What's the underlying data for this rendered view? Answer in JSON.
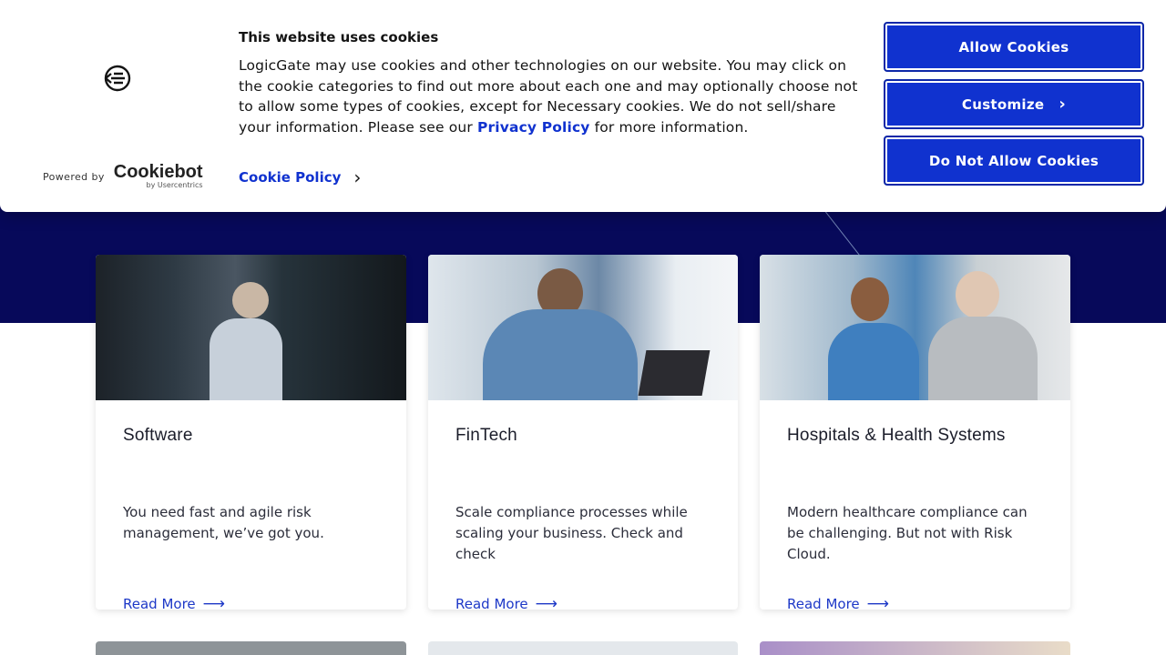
{
  "cookie_banner": {
    "title": "This website uses cookies",
    "text_before_link": "LogicGate may use cookies and other technologies on our website. You may click on the cookie categories to find out more about each one and may optionally choose not to allow some types of cookies, except for Necessary cookies.  We do not sell/share your information. Please see our ",
    "privacy_link": "Privacy Policy",
    "text_after_link": " for more information.",
    "cookie_policy_link": "Cookie Policy",
    "powered_by": "Powered by",
    "brand_name": "Cookiebot",
    "brand_sub": "by Usercentrics",
    "buttons": {
      "allow": "Allow Cookies",
      "customize": "Customize",
      "deny": "Do Not Allow Cookies"
    }
  },
  "cards": [
    {
      "title": "Software",
      "description": "You need fast and agile risk management, we’ve got you.",
      "link": "Read More"
    },
    {
      "title": "FinTech",
      "description": "Scale compliance processes while scaling your business. Check and check",
      "link": "Read More"
    },
    {
      "title": "Hospitals & Health Systems",
      "description": "Modern healthcare compliance can be challenging. But not with Risk Cloud.",
      "link": "Read More"
    }
  ],
  "colors": {
    "hero_band": "#07095a",
    "button": "#1032cf",
    "link": "#1d38c7"
  },
  "icons": {
    "banner_logo": "cookie-consent-logo-icon",
    "chevron": "chevron-right-icon",
    "arrow": "arrow-right-icon"
  }
}
